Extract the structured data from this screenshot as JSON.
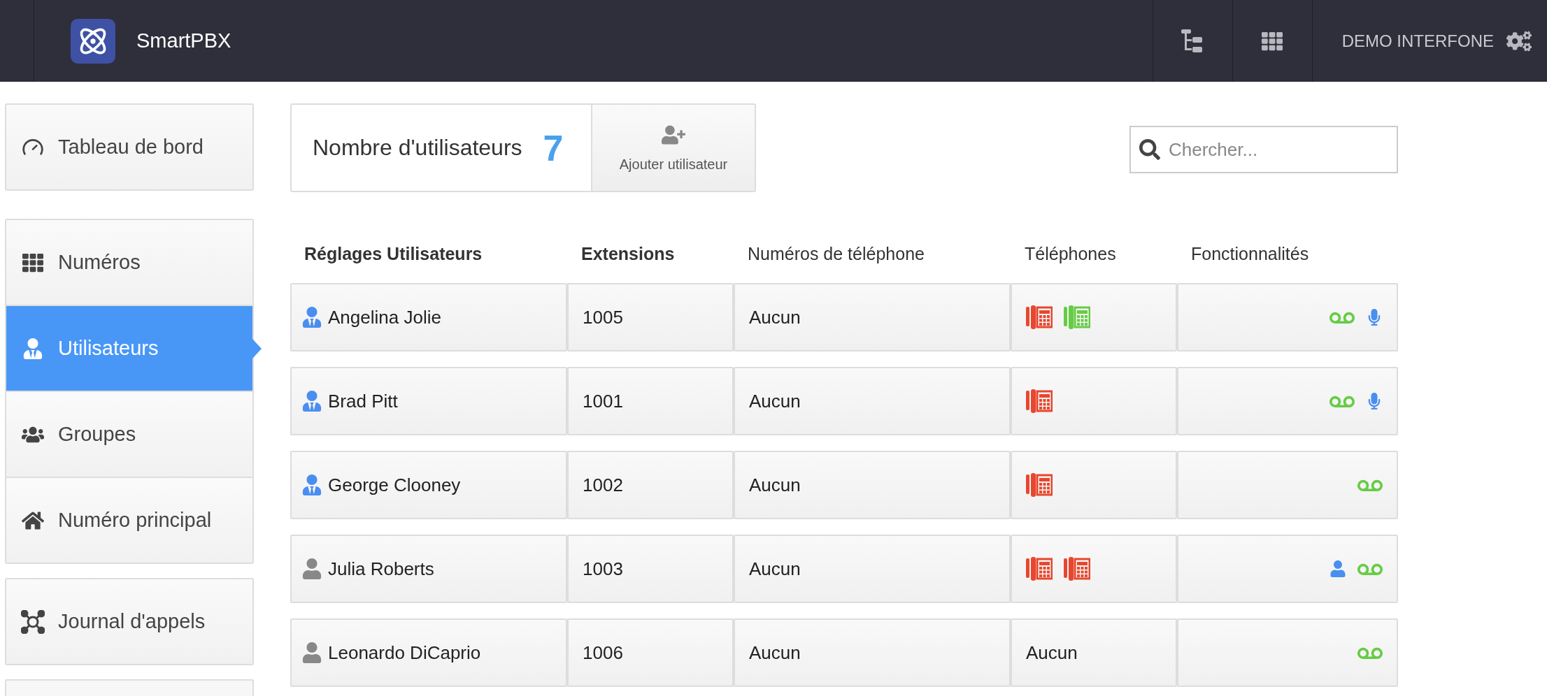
{
  "top_bar": {
    "app_name": "SmartPBX",
    "account": "DEMO INTERFONE"
  },
  "sidebar": {
    "groups": [
      [
        {
          "label": "Tableau de bord",
          "selected": false
        }
      ],
      [
        {
          "label": "Numéros",
          "selected": false
        },
        {
          "label": "Utilisateurs",
          "selected": true
        },
        {
          "label": "Groupes",
          "selected": false
        },
        {
          "label": "Numéro principal",
          "selected": false
        }
      ],
      [
        {
          "label": "Journal d'appels",
          "selected": false
        }
      ]
    ]
  },
  "summary": {
    "label": "Nombre d'utilisateurs",
    "count": "7",
    "add_button": "Ajouter utilisateur"
  },
  "search": {
    "placeholder": "Chercher..."
  },
  "table": {
    "columns": [
      {
        "label": "Réglages Utilisateurs",
        "bold": true
      },
      {
        "label": "Extensions",
        "bold": true
      },
      {
        "label": "Numéros de téléphone",
        "bold": false
      },
      {
        "label": "Téléphones",
        "bold": false
      },
      {
        "label": "Fonctionnalités",
        "bold": false
      }
    ],
    "rows": [
      {
        "kind": "staff",
        "name": "Angelina Jolie",
        "extension": "1005",
        "numbers": "Aucun",
        "phones": [
          {
            "color": "#e8472f"
          },
          {
            "color": "#66cc44"
          }
        ],
        "features": [
          {
            "kind": "voicemail"
          },
          {
            "kind": "microphone"
          }
        ]
      },
      {
        "kind": "staff",
        "name": "Brad Pitt",
        "extension": "1001",
        "numbers": "Aucun",
        "phones": [
          {
            "color": "#e8472f"
          }
        ],
        "features": [
          {
            "kind": "voicemail"
          },
          {
            "kind": "microphone"
          }
        ]
      },
      {
        "kind": "staff",
        "name": "George Clooney",
        "extension": "1002",
        "numbers": "Aucun",
        "phones": [
          {
            "color": "#e8472f"
          }
        ],
        "features": [
          {
            "kind": "voicemail"
          }
        ]
      },
      {
        "kind": "user",
        "name": "Julia Roberts",
        "extension": "1003",
        "numbers": "Aucun",
        "phones": [
          {
            "color": "#e8472f"
          },
          {
            "color": "#e8472f"
          }
        ],
        "features": [
          {
            "kind": "user"
          },
          {
            "kind": "voicemail"
          }
        ]
      },
      {
        "kind": "user",
        "name": "Leonardo DiCaprio",
        "extension": "1006",
        "numbers": "Aucun",
        "phones_text": "Aucun",
        "features": [
          {
            "kind": "voicemail"
          }
        ]
      }
    ]
  }
}
